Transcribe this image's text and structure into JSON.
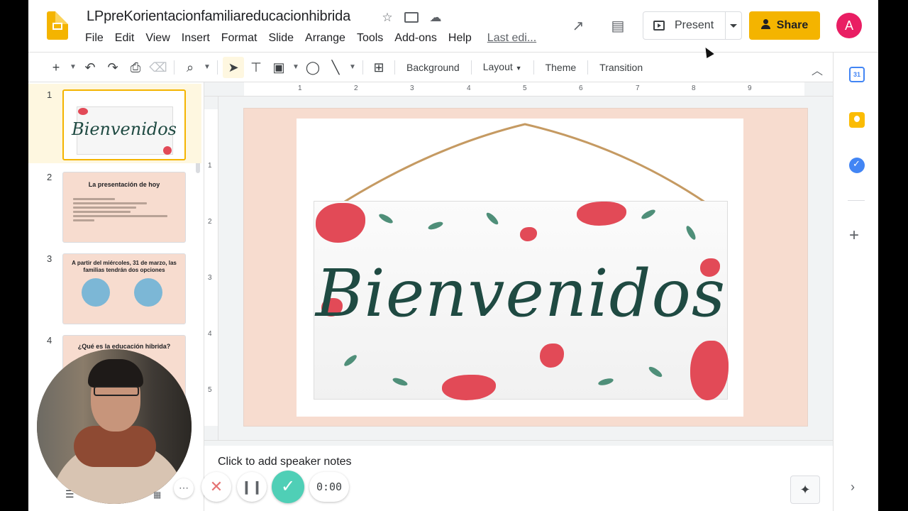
{
  "header": {
    "doc_title": "LPpreKorientacionfamiliareducacionhibrida",
    "menu": [
      "File",
      "Edit",
      "View",
      "Insert",
      "Format",
      "Slide",
      "Arrange",
      "Tools",
      "Add-ons",
      "Help"
    ],
    "last_edit": "Last edi...",
    "present_label": "Present",
    "share_label": "Share",
    "avatar_letter": "A"
  },
  "toolbar": {
    "background": "Background",
    "layout": "Layout",
    "theme": "Theme",
    "transition": "Transition"
  },
  "ruler": {
    "h": [
      "1",
      "2",
      "3",
      "4",
      "5",
      "6",
      "7",
      "8",
      "9"
    ],
    "v": [
      "1",
      "2",
      "3",
      "4",
      "5"
    ]
  },
  "slides": [
    {
      "num": "1",
      "title": "Bienvenidos"
    },
    {
      "num": "2",
      "title": "La presentación de hoy"
    },
    {
      "num": "3",
      "title": "A partir del miércoles, 31 de marzo, las familias tendrán dos opciones"
    },
    {
      "num": "4",
      "title": "¿Qué es la educación híbrida?"
    }
  ],
  "main_slide": {
    "sign_text": "Bienvenidos"
  },
  "notes": {
    "placeholder": "Click to add speaker notes"
  },
  "recorder": {
    "time": "0:00"
  },
  "side_panel": {
    "calendar_day": "31"
  },
  "colors": {
    "accent": "#f4b400",
    "avatar": "#e91e63",
    "record_check": "#4fcfb6"
  }
}
